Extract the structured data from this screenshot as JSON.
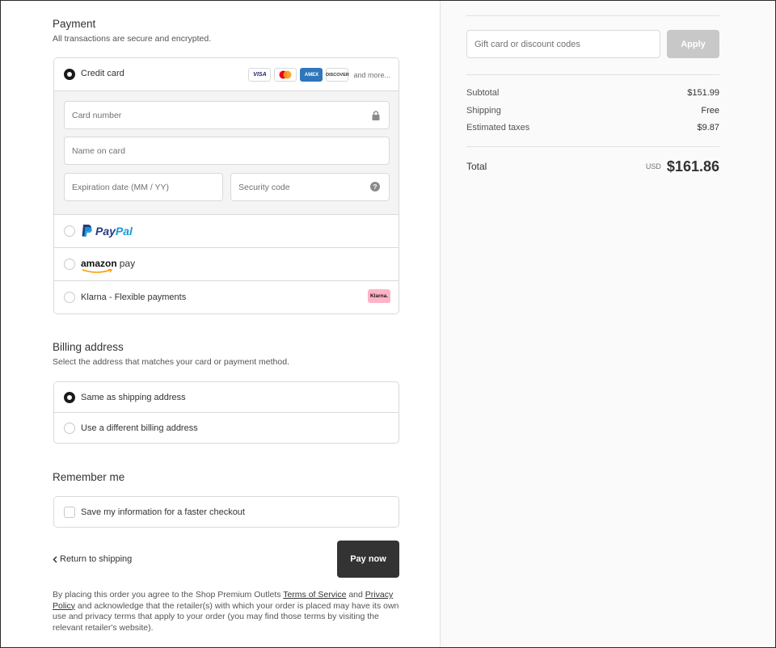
{
  "payment": {
    "heading": "Payment",
    "subtext": "All transactions are secure and encrypted.",
    "credit_card": {
      "label": "Credit card",
      "logos": [
        "VISA",
        "Mastercard",
        "AMEX",
        "DISCOVER"
      ],
      "and_more": "and more...",
      "card_number_placeholder": "Card number",
      "name_placeholder": "Name on card",
      "expiry_placeholder": "Expiration date (MM / YY)",
      "security_placeholder": "Security code"
    },
    "paypal": {
      "brand_pay": "Pay",
      "brand_pal": "Pal"
    },
    "amazon": {
      "brand_amazon": "amazon",
      "brand_pay": "pay"
    },
    "klarna": {
      "label": "Klarna - Flexible payments",
      "badge": "Klarna."
    }
  },
  "billing": {
    "heading": "Billing address",
    "subtext": "Select the address that matches your card or payment method.",
    "options": [
      "Same as shipping address",
      "Use a different billing address"
    ]
  },
  "remember": {
    "heading": "Remember me",
    "checkbox_label": "Save my information for a faster checkout"
  },
  "actions": {
    "back_label": "Return to shipping",
    "pay_label": "Pay now"
  },
  "legal": {
    "part1": "By placing this order you agree to the Shop Premium Outlets ",
    "terms_link": "Terms of Service",
    "part2": " and ",
    "privacy_link": "Privacy Policy",
    "part3": " and acknowledge that the retailer(s) with which your order is placed may have its own use and privacy terms that apply to your order (you may find those terms by visiting the relevant retailer's website)."
  },
  "summary": {
    "gift_placeholder": "Gift card or discount codes",
    "apply_label": "Apply",
    "subtotal_label": "Subtotal",
    "subtotal_value": "$151.99",
    "shipping_label": "Shipping",
    "shipping_value": "Free",
    "taxes_label": "Estimated taxes",
    "taxes_value": "$9.87",
    "total_label": "Total",
    "currency": "USD",
    "total_value": "$161.86"
  },
  "colors": {
    "pay_button": "#333333",
    "apply_disabled": "#c8c8c8",
    "paypal_dark": "#253b80",
    "paypal_light": "#179bd7",
    "klarna_pink": "#ffb3c7"
  }
}
